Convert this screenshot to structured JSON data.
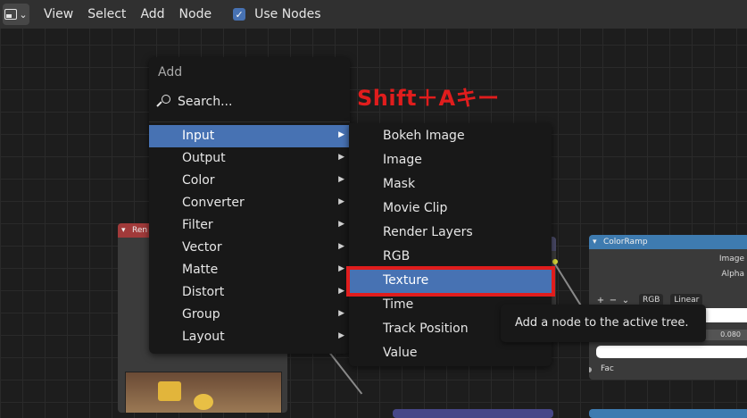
{
  "header": {
    "menus": [
      "View",
      "Select",
      "Add",
      "Node"
    ],
    "use_nodes_label": "Use Nodes",
    "use_nodes_checked": true
  },
  "annotation": "Shift＋Aキー",
  "add_menu": {
    "title": "Add",
    "search_label": "Search...",
    "items": [
      {
        "label": "Input",
        "active": true
      },
      {
        "label": "Output"
      },
      {
        "label": "Color"
      },
      {
        "label": "Converter"
      },
      {
        "label": "Filter"
      },
      {
        "label": "Vector"
      },
      {
        "label": "Matte"
      },
      {
        "label": "Distort"
      },
      {
        "label": "Group"
      },
      {
        "label": "Layout"
      }
    ]
  },
  "input_submenu": {
    "items": [
      "Bokeh Image",
      "Image",
      "Mask",
      "Movie Clip",
      "Render Layers",
      "RGB",
      "Texture",
      "Time",
      "Track Position",
      "Value"
    ],
    "active_index": 6
  },
  "tooltip": "Add a node to the active tree.",
  "nodes": {
    "render_layers_title": "Ren",
    "colorramp": {
      "title": "ColorRamp",
      "outputs": [
        "Image",
        "Alpha"
      ],
      "controls": {
        "add": "+",
        "remove": "−",
        "mode": "RGB",
        "interpolation": "Linear"
      },
      "pos_value": "0.080",
      "input": "Fac"
    }
  },
  "colors": {
    "accent": "#4772b3",
    "highlight_red": "#e01d1d",
    "menu_bg": "#181818",
    "header_bg": "#303030"
  }
}
